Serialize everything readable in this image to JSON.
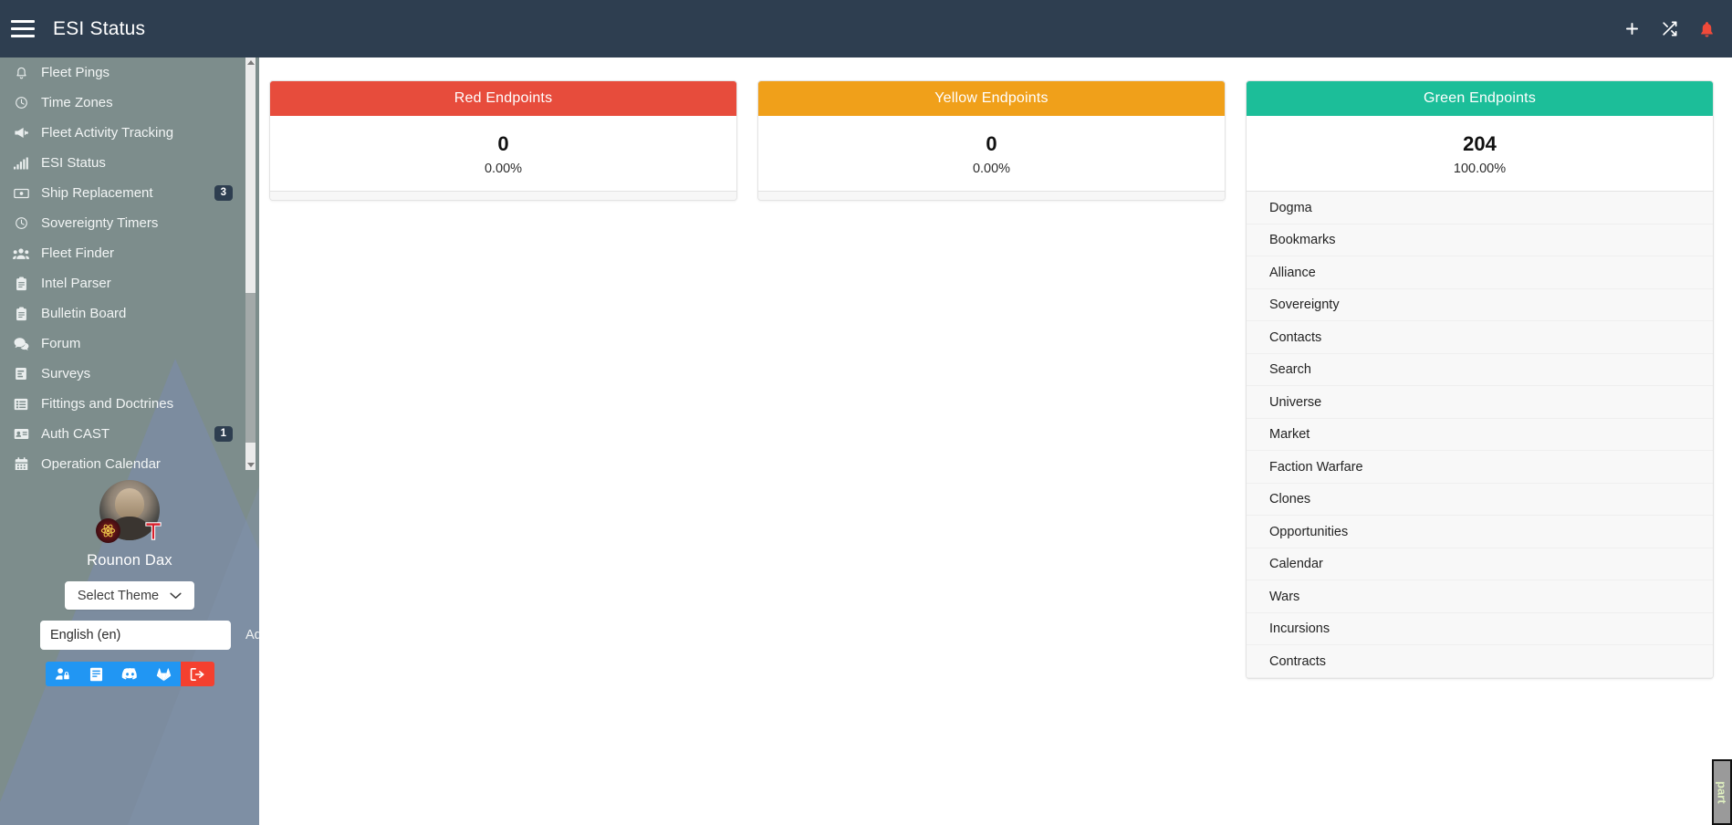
{
  "topbar": {
    "title": "ESI Status",
    "menu_icon": "hamburger-menu-icon",
    "icons": [
      {
        "name": "plus-icon",
        "glyph": "+"
      },
      {
        "name": "shuffle-icon",
        "glyph": "shuffle"
      },
      {
        "name": "bell-icon",
        "glyph": "bell"
      }
    ]
  },
  "sidebar": {
    "items": [
      {
        "label": "Fleet Pings",
        "icon": "bell-icon",
        "badge": ""
      },
      {
        "label": "Time Zones",
        "icon": "clock-icon",
        "badge": ""
      },
      {
        "label": "Fleet Activity Tracking",
        "icon": "bullhorn-icon",
        "badge": ""
      },
      {
        "label": "ESI Status",
        "icon": "signal-bars-icon",
        "badge": ""
      },
      {
        "label": "Ship Replacement",
        "icon": "money-bill-icon",
        "badge": "3"
      },
      {
        "label": "Sovereignty Timers",
        "icon": "clock-icon",
        "badge": ""
      },
      {
        "label": "Fleet Finder",
        "icon": "users-icon",
        "badge": ""
      },
      {
        "label": "Intel Parser",
        "icon": "clipboard-icon",
        "badge": ""
      },
      {
        "label": "Bulletin Board",
        "icon": "clipboard-icon",
        "badge": ""
      },
      {
        "label": "Forum",
        "icon": "comments-icon",
        "badge": ""
      },
      {
        "label": "Surveys",
        "icon": "poll-icon",
        "badge": ""
      },
      {
        "label": "Fittings and Doctrines",
        "icon": "list-alt-icon",
        "badge": ""
      },
      {
        "label": "Auth CAST",
        "icon": "id-card-icon",
        "badge": "1"
      },
      {
        "label": "Operation Calendar",
        "icon": "calendar-icon",
        "badge": ""
      }
    ],
    "user": {
      "name": "Rounon Dax",
      "avatar_name": "user-avatar",
      "theme_button": "Select Theme",
      "language_value": "English (en)",
      "language_placeholder": "English (en)",
      "admin_label": "Admin",
      "actions": [
        {
          "name": "user-lock-icon",
          "style": "blue"
        },
        {
          "name": "book-icon",
          "style": "blue"
        },
        {
          "name": "discord-icon",
          "style": "blue"
        },
        {
          "name": "gitlab-icon",
          "style": "blue"
        },
        {
          "name": "logout-icon",
          "style": "red"
        }
      ]
    }
  },
  "main": {
    "cards": [
      {
        "title": "Red Endpoints",
        "count": "0",
        "percent": "0.00%",
        "color": "#e74c3c",
        "style": "head-red",
        "endpoints": []
      },
      {
        "title": "Yellow Endpoints",
        "count": "0",
        "percent": "0.00%",
        "color": "#f0a01a",
        "style": "head-yellow",
        "endpoints": []
      },
      {
        "title": "Green Endpoints",
        "count": "204",
        "percent": "100.00%",
        "color": "#1cbe99",
        "style": "head-green",
        "endpoints": [
          "Dogma",
          "Bookmarks",
          "Alliance",
          "Sovereignty",
          "Contacts",
          "Search",
          "Universe",
          "Market",
          "Faction Warfare",
          "Clones",
          "Opportunities",
          "Calendar",
          "Wars",
          "Incursions",
          "Contracts"
        ]
      }
    ]
  },
  "corner": {
    "label": "part"
  },
  "colors": {
    "navbar": "#2e3e50",
    "sidebar": "#7d8d8c",
    "red": "#e74c3c",
    "yellow": "#f0a01a",
    "green": "#1cbe99",
    "action_blue": "#2196f3",
    "action_red": "#f4402f",
    "badge": "#2e3e50"
  }
}
